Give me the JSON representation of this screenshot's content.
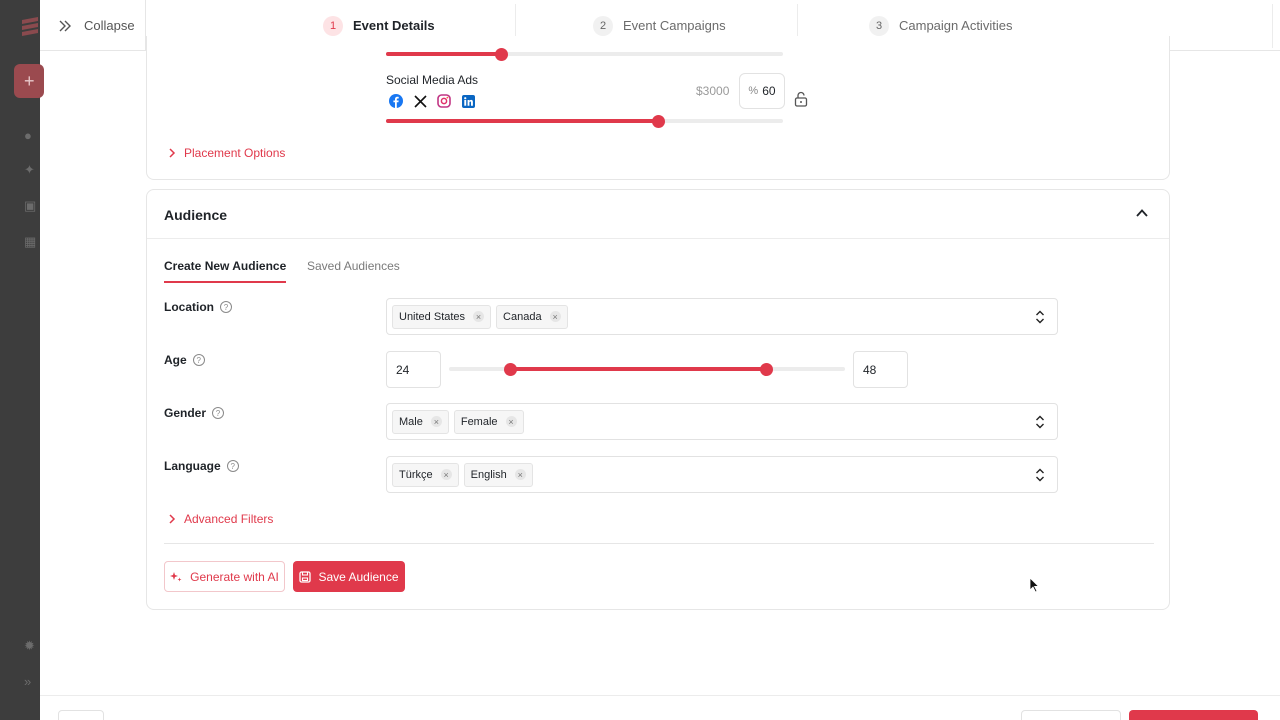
{
  "topbar": {
    "collapse_label": "Collapse",
    "steps": [
      {
        "num": "1",
        "label": "Event Details",
        "active": true
      },
      {
        "num": "2",
        "label": "Event Campaigns",
        "active": false
      },
      {
        "num": "3",
        "label": "Campaign Activities",
        "active": false
      }
    ]
  },
  "budget": {
    "prev_slider_fraction": 0.29,
    "channel": {
      "label": "Social Media Ads",
      "icons": [
        "facebook-icon",
        "x-icon",
        "instagram-icon",
        "linkedin-icon"
      ],
      "amount": "$3000",
      "percent_symbol": "%",
      "percent_value": "60",
      "slider_fraction": 0.685
    },
    "placement_options_label": "Placement Options"
  },
  "audience": {
    "title": "Audience",
    "tabs": [
      "Create New Audience",
      "Saved Audiences"
    ],
    "location": {
      "label": "Location",
      "chips": [
        "United States",
        "Canada"
      ]
    },
    "age": {
      "label": "Age",
      "min": "24",
      "max": "48"
    },
    "gender": {
      "label": "Gender",
      "chips": [
        "Male",
        "Female"
      ]
    },
    "language": {
      "label": "Language",
      "chips": [
        "Türkçe",
        "English"
      ]
    },
    "advanced_filters_label": "Advanced Filters",
    "generate_ai_label": "Generate with AI",
    "save_audience_label": "Save Audience"
  },
  "colors": {
    "accent": "#e0394b",
    "accent_light": "#fde3e5"
  }
}
